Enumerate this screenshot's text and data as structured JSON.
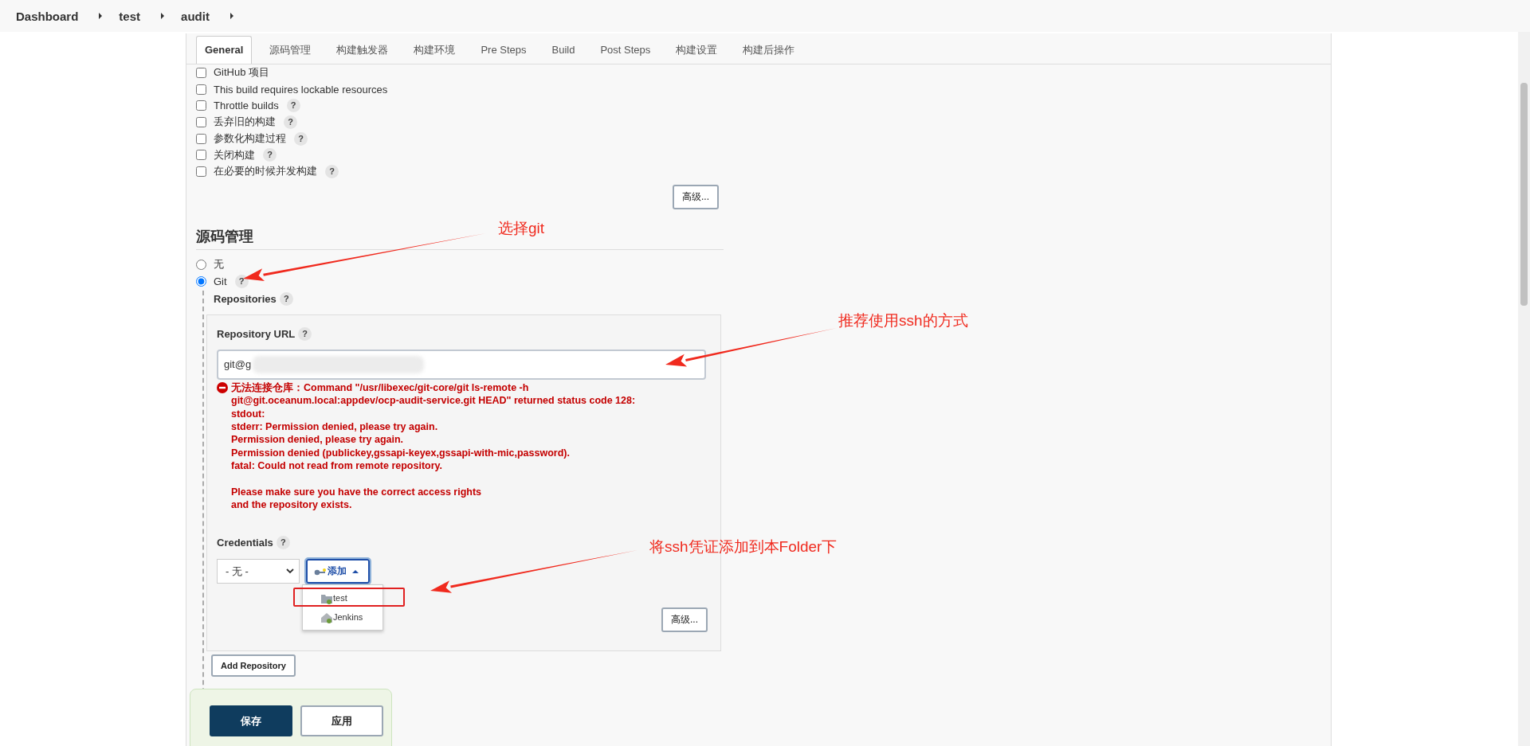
{
  "breadcrumbs": [
    "Dashboard",
    "test",
    "audit"
  ],
  "tabs": [
    {
      "label": "General",
      "selected": true
    },
    {
      "label": "源码管理",
      "selected": false
    },
    {
      "label": "构建触发器",
      "selected": false
    },
    {
      "label": "构建环境",
      "selected": false
    },
    {
      "label": "Pre Steps",
      "selected": false
    },
    {
      "label": "Build",
      "selected": false
    },
    {
      "label": "Post Steps",
      "selected": false
    },
    {
      "label": "构建设置",
      "selected": false
    },
    {
      "label": "构建后操作",
      "selected": false
    }
  ],
  "general_options": [
    {
      "label": "GitHub 项目",
      "checked": false
    },
    {
      "label": "This build requires lockable resources",
      "checked": false
    },
    {
      "label": "Throttle builds",
      "checked": false,
      "help": "?"
    },
    {
      "label": "丢弃旧的构建",
      "checked": false,
      "help": "?"
    },
    {
      "label": "参数化构建过程",
      "checked": false,
      "help": "?"
    },
    {
      "label": "关闭构建",
      "checked": false,
      "help": "?"
    },
    {
      "label": "在必要的时候并发构建",
      "checked": false,
      "help": "?"
    }
  ],
  "general_advanced": "高级...",
  "scm": {
    "heading": "源码管理",
    "options": [
      {
        "label": "无",
        "selected": false
      },
      {
        "label": "Git",
        "selected": true,
        "help": "?"
      }
    ],
    "repositories_label": "Repositories",
    "repositories_help": "?",
    "repository": {
      "url_label": "Repository URL",
      "url_help": "?",
      "url_value": "git@g",
      "error_paragraphs": [
        [
          "无法连接仓库：Command \"/usr/libexec/git-core/git ls-remote -h",
          "git@git.oceanum.local:appdev/ocp-audit-service.git HEAD\" returned status code 128:",
          "stdout:",
          "stderr: Permission denied, please try again.",
          "Permission denied, please try again.",
          "Permission denied (publickey,gssapi-keyex,gssapi-with-mic,password).",
          "fatal: Could not read from remote repository."
        ],
        [
          "Please make sure you have the correct access rights",
          "and the repository exists."
        ]
      ],
      "credentials_label": "Credentials",
      "credentials_help": "?",
      "credentials_value": "- 无 -",
      "add_button": "添加",
      "add_menu": [
        {
          "label": "test",
          "kind": "folder",
          "boxed": true
        },
        {
          "label": "Jenkins",
          "kind": "home",
          "boxed": false
        }
      ],
      "advanced": "高级..."
    },
    "add_repository": "Add Repository"
  },
  "actions": [
    {
      "label": "保存",
      "kind": "primary"
    },
    {
      "label": "应用",
      "kind": "secondary"
    }
  ],
  "annotations": [
    {
      "text": "选择git"
    },
    {
      "text": "推荐使用ssh的方式"
    },
    {
      "text": "将ssh凭证添加到本Folder下"
    }
  ]
}
